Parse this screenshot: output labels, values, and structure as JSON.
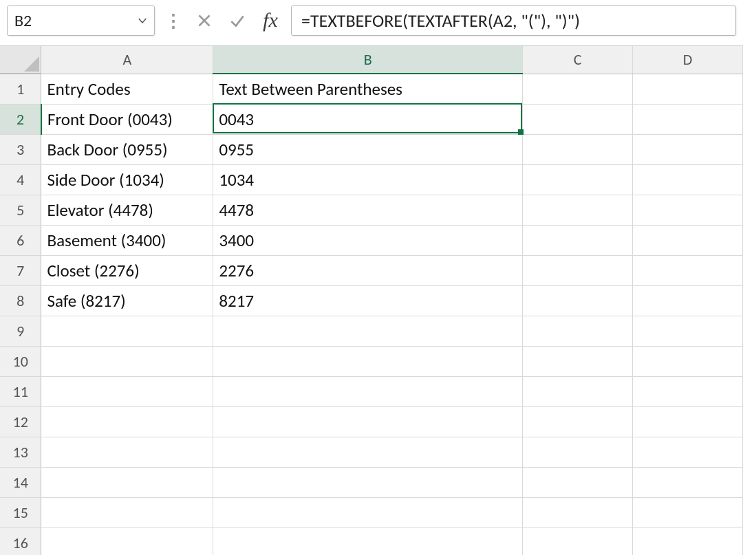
{
  "namebox": {
    "value": "B2"
  },
  "formula_bar": {
    "formula": "=TEXTBEFORE(TEXTAFTER(A2, \"(\"), \")\")"
  },
  "columns": [
    "A",
    "B",
    "C",
    "D"
  ],
  "active": {
    "col": "B",
    "row": 2
  },
  "headers": {
    "A": "Entry Codes",
    "B": "Text Between Parentheses"
  },
  "rows": [
    {
      "n": 1,
      "A": "Entry Codes",
      "B": "Text Between Parentheses",
      "bold": true
    },
    {
      "n": 2,
      "A": "Front Door (0043)",
      "B": "0043"
    },
    {
      "n": 3,
      "A": "Back Door (0955)",
      "B": "0955"
    },
    {
      "n": 4,
      "A": "Side Door (1034)",
      "B": "1034"
    },
    {
      "n": 5,
      "A": "Elevator (4478)",
      "B": "4478"
    },
    {
      "n": 6,
      "A": "Basement (3400)",
      "B": "3400"
    },
    {
      "n": 7,
      "A": "Closet (2276)",
      "B": "2276"
    },
    {
      "n": 8,
      "A": "Safe (8217)",
      "B": "8217"
    },
    {
      "n": 9,
      "A": "",
      "B": ""
    },
    {
      "n": 10,
      "A": "",
      "B": ""
    },
    {
      "n": 11,
      "A": "",
      "B": ""
    },
    {
      "n": 12,
      "A": "",
      "B": ""
    },
    {
      "n": 13,
      "A": "",
      "B": ""
    },
    {
      "n": 14,
      "A": "",
      "B": ""
    },
    {
      "n": 15,
      "A": "",
      "B": ""
    },
    {
      "n": 16,
      "A": "",
      "B": ""
    }
  ],
  "icons": {
    "cancel": "×",
    "accept": "✓"
  }
}
